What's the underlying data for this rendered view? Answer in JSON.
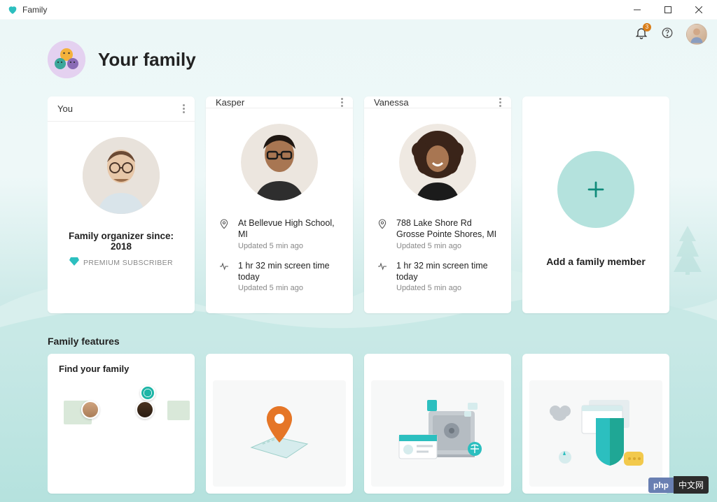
{
  "window": {
    "title": "Family"
  },
  "toolbar": {
    "notifications_badge": "3"
  },
  "header": {
    "title": "Your family"
  },
  "members": [
    {
      "name": "You",
      "organizer_line": "Family organizer since: 2018",
      "premium_label": "PREMIUM SUBSCRIBER"
    },
    {
      "name": "Kasper",
      "location": "At Bellevue High School, MI",
      "location_updated": "Updated 5 min ago",
      "screen_time": "1 hr 32 min screen time today",
      "screen_time_updated": "Updated 5 min ago"
    },
    {
      "name": "Vanessa",
      "location_line1": "788 Lake Shore Rd",
      "location_line2": "Grosse Pointe Shores, MI",
      "location_updated": "Updated 5 min ago",
      "screen_time": "1 hr 32 min screen time today",
      "screen_time_updated": "Updated 5 min ago"
    }
  ],
  "add_member": {
    "label": "Add a family member"
  },
  "features": {
    "section_title": "Family features",
    "find_label": "Find your family"
  },
  "watermark": {
    "left": "php",
    "right": "中文网"
  }
}
